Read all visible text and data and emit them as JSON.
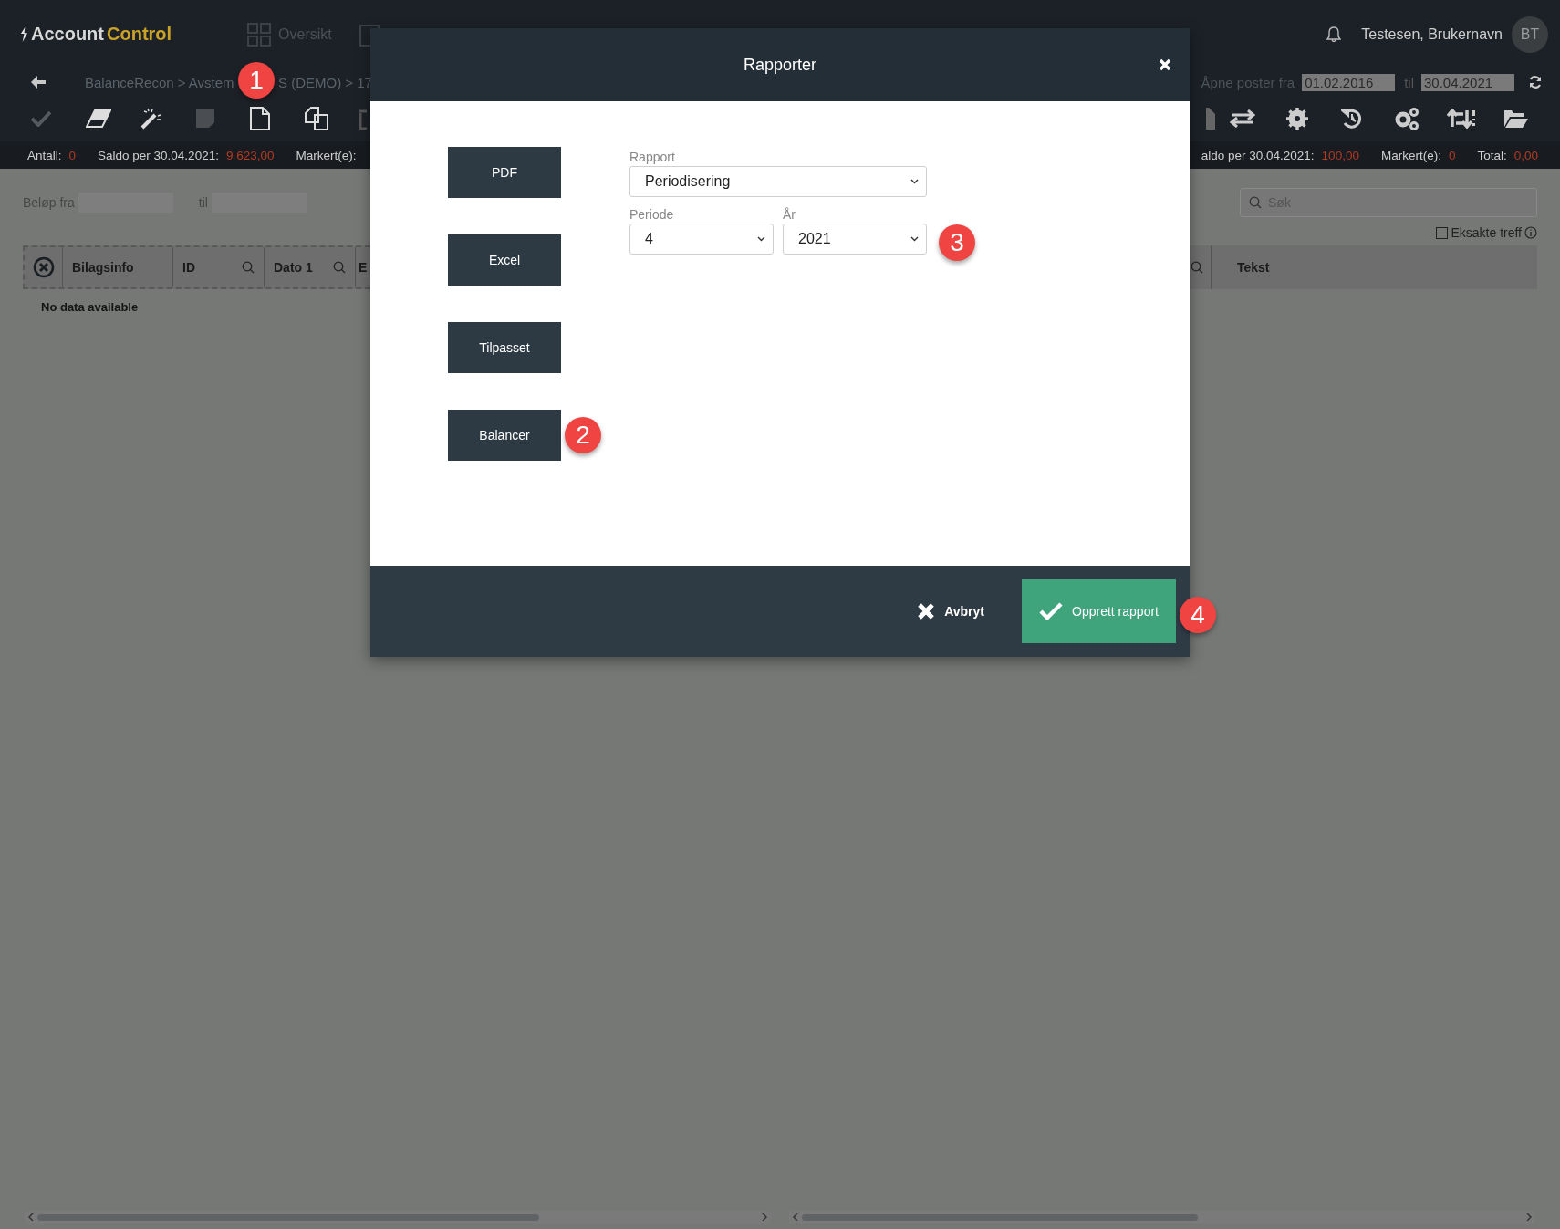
{
  "header": {
    "logo": {
      "first": "Account",
      "second": "Control"
    },
    "nav": [
      {
        "label": "Oversikt"
      }
    ],
    "user": "Testesen, Brukernavn",
    "avatar": "BT"
  },
  "breadcrumb": {
    "start": "BalanceRecon > Avstem",
    "end": "S (DEMO) > 17"
  },
  "open_items": {
    "label": "Åpne poster fra",
    "from": "01.02.2016",
    "to_label": "til",
    "to": "30.04.2021"
  },
  "status_left": [
    {
      "label": "Antall:",
      "value": "0"
    },
    {
      "label": "Saldo per 30.04.2021:",
      "value": "9 623,00"
    },
    {
      "label": "Markert(e):"
    }
  ],
  "status_right": [
    {
      "label": "aldo per 30.04.2021:",
      "value": "100,00"
    },
    {
      "label": "Markert(e):",
      "value": "0"
    },
    {
      "label": "Total:",
      "value": "0,00"
    }
  ],
  "filter": {
    "from_label": "Beløp fra",
    "to_label": "til"
  },
  "search": {
    "placeholder": "Søk"
  },
  "exact_match": {
    "label": "Eksakte treff",
    "checked": false
  },
  "table": {
    "columns_left": [
      {
        "label": "Bilagsinfo",
        "searchable": false
      },
      {
        "label": "ID",
        "searchable": true
      },
      {
        "label": "Dato 1",
        "searchable": true
      },
      {
        "label": "E",
        "searchable": false
      }
    ],
    "columns_right": [
      {
        "searchable": true
      },
      {
        "label": "Tekst",
        "searchable": false
      }
    ],
    "empty_text": "No data available"
  },
  "dialog": {
    "title": "Rapporter",
    "format_buttons": [
      "PDF",
      "Excel",
      "Tilpasset",
      "Balancer"
    ],
    "report": {
      "label": "Rapport",
      "value": "Periodisering"
    },
    "period": {
      "label": "Periode",
      "value": "4"
    },
    "year": {
      "label": "År",
      "value": "2021"
    },
    "cancel": "Avbryt",
    "confirm": "Opprett rapport"
  },
  "callouts": [
    "1",
    "2",
    "3",
    "4"
  ]
}
